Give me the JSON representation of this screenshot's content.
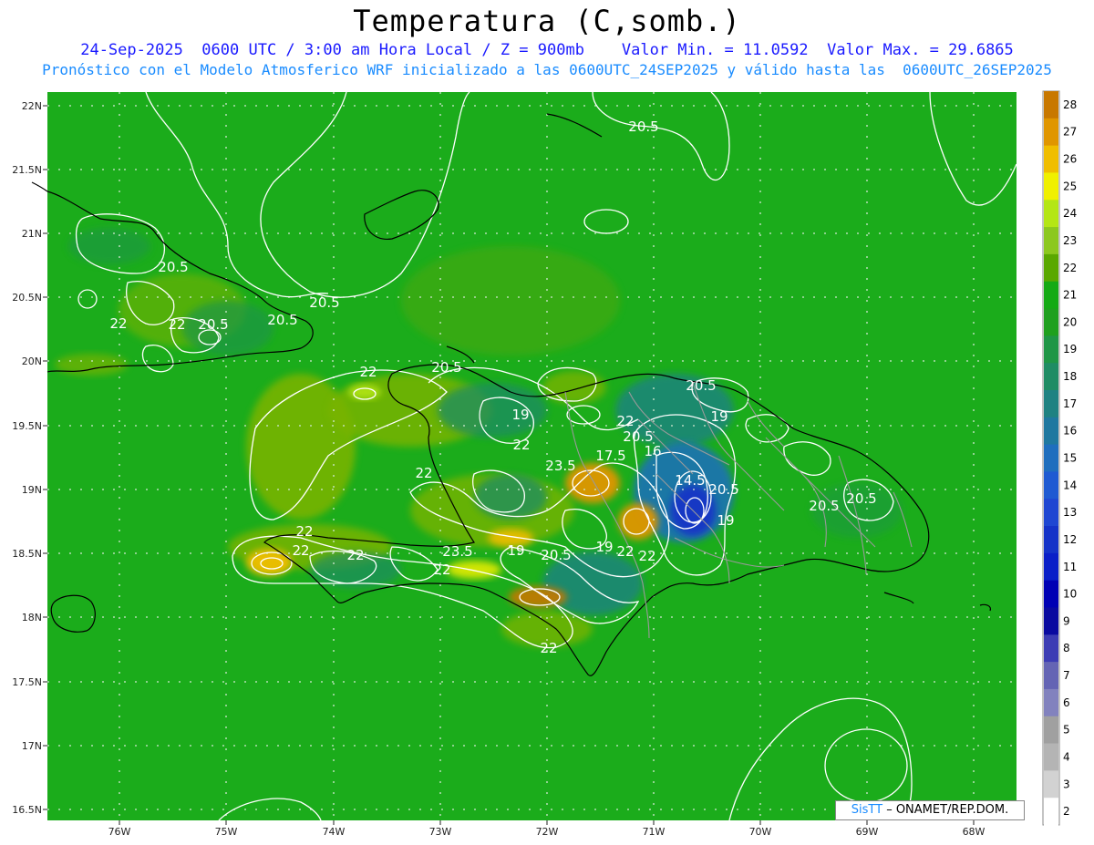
{
  "header": {
    "title": "Temperatura (C,somb.)",
    "date": "24-Sep-2025",
    "time": "0600 UTC / 3:00 am Hora Local / Z = 900mb",
    "vmin": "Valor Min. = 11.0592",
    "vmax": "Valor Max. = 29.6865",
    "subtitle": "Pronóstico con el Modelo Atmosferico WRF inicializado a las 0600UTC_24SEP2025 y válido hasta las  0600UTC_26SEP2025"
  },
  "map": {
    "lat_labels": [
      "22N",
      "21.5N",
      "21N",
      "20.5N",
      "20N",
      "19.5N",
      "19N",
      "18.5N",
      "18N",
      "17.5N",
      "17N",
      "16.5N"
    ],
    "lon_labels": [
      "76W",
      "75W",
      "74W",
      "73W",
      "72W",
      "71W",
      "70W",
      "69W",
      "68W"
    ],
    "contour_labels": [
      "20.5",
      "20.5",
      "20.5",
      "20.5",
      "20.5",
      "20.5",
      "22",
      "22",
      "22",
      "22",
      "22",
      "22",
      "22",
      "22",
      "22",
      "19",
      "19",
      "19",
      "19",
      "16",
      "14.5",
      "17.5",
      "23.5",
      "20.5",
      "20.5",
      "20.5",
      "20.5",
      "22",
      "22",
      "23.5",
      "22",
      "19",
      "20.5",
      "22"
    ],
    "background_color": "#1bac1b"
  },
  "colorbar": {
    "levels": [
      "28",
      "27",
      "26",
      "25",
      "24",
      "23",
      "22",
      "21",
      "20",
      "19",
      "18",
      "17",
      "16",
      "15",
      "14",
      "13",
      "12",
      "11",
      "10",
      "9",
      "8",
      "7",
      "6",
      "5",
      "4",
      "3",
      "2"
    ],
    "colors": [
      "#c87800",
      "#e09600",
      "#f0be00",
      "#f0f000",
      "#b4e614",
      "#8cc81e",
      "#5aa800",
      "#14aa14",
      "#1ea01e",
      "#1e9646",
      "#1e8c64",
      "#1e8282",
      "#1e78a0",
      "#1e6ebe",
      "#1e5ad2",
      "#1e46d2",
      "#1432c8",
      "#0a1ec8",
      "#0000b4",
      "#0a0aa0",
      "#3c3cb4",
      "#6464b4",
      "#8282be",
      "#a0a0a0",
      "#b4b4b4",
      "#d2d2d2",
      "#ffffff"
    ]
  },
  "credit": {
    "brand": "SisTT",
    "org": "ONAMET/REP.DOM."
  }
}
